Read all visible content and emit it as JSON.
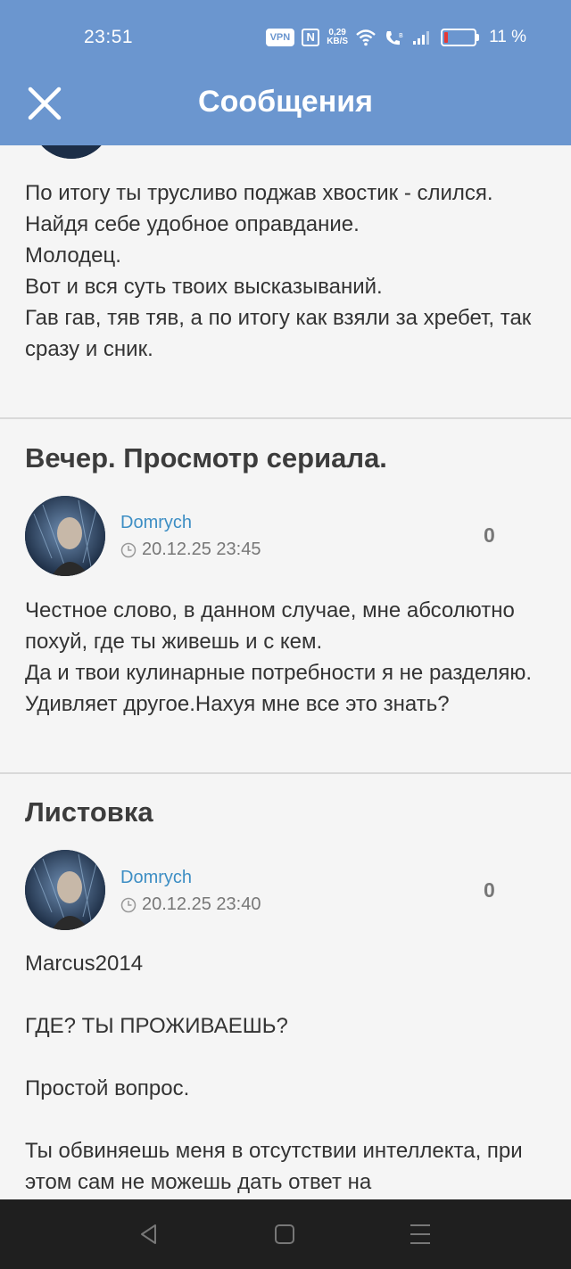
{
  "status_bar": {
    "time": "23:51",
    "vpn": "VPN",
    "nfc": "N",
    "speed_value": "0,29",
    "speed_unit": "KB/S",
    "battery_level_percent": 11,
    "battery_text": "11 %"
  },
  "header": {
    "title": "Сообщения",
    "close_icon": "close-icon",
    "background": "#6b96cf"
  },
  "posts": [
    {
      "text": "По итогу ты трусливо поджав хвостик - слился.\nНайдя себе удобное оправдание.\nМолодец.\nВот и вся суть твоих высказываний.\nГав гав, тяв тяв, а по итогу как взяли за хребет, так сразу и сник."
    },
    {
      "title": "Вечер. Просмотр сериала.",
      "author": "Domrych",
      "datetime": "20.12.25 23:45",
      "likes": "0",
      "text": "Честное слово, в данном случае, мне абсолютно похуй, где ты живешь и с кем.\nДа и твои кулинарные потребности я не разделяю.\nУдивляет другое.Нахуя мне все это знать?"
    },
    {
      "title": "Листовка",
      "author": "Domrych",
      "datetime": "20.12.25 23:40",
      "likes": "0",
      "text": "Marcus2014\n\nГДЕ? ТЫ ПРОЖИВАЕШЬ?\n\nПростой вопрос.\n\nТы обвиняешь меня в отсутствии интеллекта, при этом сам не можешь дать ответ на"
    }
  ],
  "nav": {
    "back_icon": "back-triangle-icon",
    "home_icon": "home-square-icon",
    "menu_icon": "menu-lines-icon"
  },
  "colors": {
    "accent": "#6b96cf",
    "link": "#3d8ec4",
    "text": "#333333",
    "background": "#f5f5f5"
  }
}
